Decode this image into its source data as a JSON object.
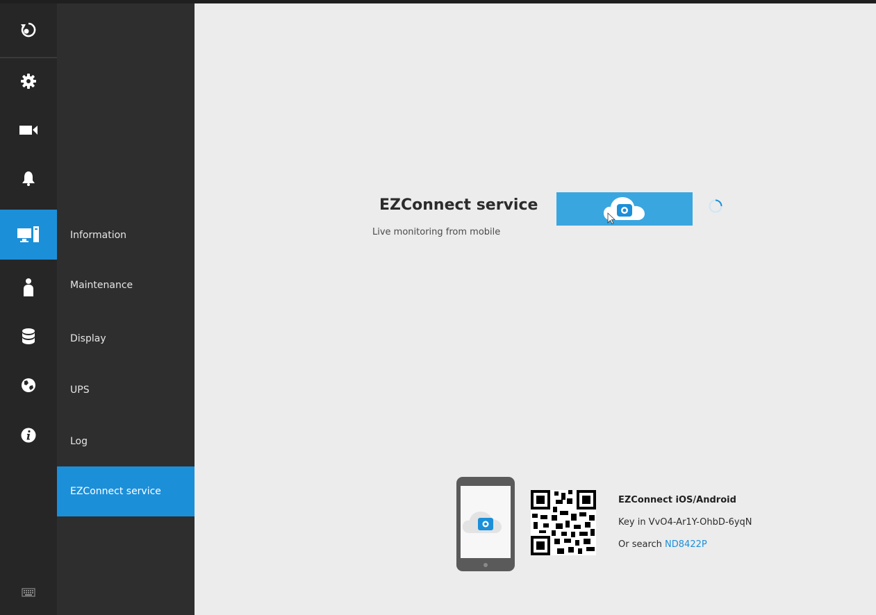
{
  "rail": {
    "items": [
      {
        "icon": "back-icon"
      },
      {
        "icon": "gear-icon"
      },
      {
        "icon": "camera-icon"
      },
      {
        "icon": "bell-icon"
      },
      {
        "icon": "system-icon",
        "active": true
      },
      {
        "icon": "user-icon"
      },
      {
        "icon": "storage-icon"
      },
      {
        "icon": "network-icon"
      },
      {
        "icon": "info-icon"
      }
    ],
    "bottom_icon": "keyboard-icon"
  },
  "submenu": {
    "items": [
      {
        "label": "Information"
      },
      {
        "label": "Maintenance"
      },
      {
        "label": "Display"
      },
      {
        "label": "UPS"
      },
      {
        "label": "Log"
      },
      {
        "label": "EZConnect service",
        "active": true
      }
    ]
  },
  "service": {
    "title": "EZConnect service",
    "subtitle": "Live monitoring from mobile",
    "button_icon": "cloud-camera-icon"
  },
  "app": {
    "title": "EZConnect iOS/Android",
    "key_text": "Key in VvO4-Ar1Y-OhbD-6yqN",
    "search_prefix": "Or search",
    "search_link": "ND8422P"
  },
  "colors": {
    "accent": "#1c8fd9",
    "button": "#3aa6df",
    "rail_bg": "#262626",
    "submenu_bg": "#2e2e2e",
    "main_bg": "#ececec"
  }
}
